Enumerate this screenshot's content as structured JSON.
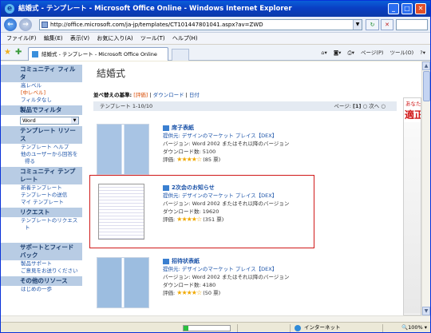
{
  "window": {
    "title": "結婚式 - テンプレート - Microsoft Office Online - Windows Internet Explorer",
    "minimize": "_",
    "maximize": "□",
    "close": "✕"
  },
  "address": {
    "url": "http://office.microsoft.com/ja-jp/templates/CT101447801041.aspx?av=ZWD",
    "refresh": "↻",
    "stop": "✕"
  },
  "menu": {
    "items": [
      "ファイル(F)",
      "編集(E)",
      "表示(V)",
      "お気に入り(A)",
      "ツール(T)",
      "ヘルプ(H)"
    ]
  },
  "tab": {
    "label": "結婚式 - テンプレート - Microsoft Office Online"
  },
  "commands": {
    "page": "ページ(P)",
    "tools": "ツール(O)"
  },
  "sidebar": {
    "community_filter": "コミュニティ フィルタ",
    "community_items": [
      "高レベル",
      "[中レベル]",
      "フィルタなし"
    ],
    "product_filter": "製品でフィルタ",
    "product_select": "Word",
    "template_resources": "テンプレート リソース",
    "resource_items": [
      "テンプレート ヘルプ",
      "他のユーザーから回答を得る"
    ],
    "community_templates": "コミュニティ テンプレート",
    "community_template_items": [
      "新着テンプレート",
      "テンプレートの送信",
      "マイ テンプレート"
    ],
    "request": "リクエスト",
    "request_items": [
      "テンプレートのリクエスト"
    ],
    "support": "サポートとフィードバック",
    "support_items": [
      "製品サポート",
      "ご意見をお送りください"
    ],
    "other": "その他のリソース",
    "other_items": [
      "はじめの一歩"
    ]
  },
  "main": {
    "title": "結婚式",
    "sort_label": "並べ替えの基準:",
    "sort_active": "[評価]",
    "sort_downloads": "ダウンロード",
    "sort_date": "日付",
    "count": "テンプレート 1-10/10",
    "page_label": "ページ:",
    "page_current": "[1]",
    "next": "次へ"
  },
  "templates": [
    {
      "name": "席子表紙",
      "provider": "提供元: デザインのマーケット プレイス【DEX】",
      "version": "バージョン: Word 2002 またはそれ以降のバージョン",
      "downloads": "ダウンロード数: 5100",
      "rating_label": "評価:",
      "rating": 4,
      "votes": "(85 票)"
    },
    {
      "name": "2次会のお知らせ",
      "provider": "提供元: デザインのマーケット プレイス【DEX】",
      "version": "バージョン: Word 2002 またはそれ以降のバージョン",
      "downloads": "ダウンロード数: 19620",
      "rating_label": "評価:",
      "rating": 4,
      "votes": "(351 票)"
    },
    {
      "name": "招待状表紙",
      "provider": "提供元: デザインのマーケット プレイス【DEX】",
      "version": "バージョン: Word 2002 またはそれ以降のバージョン",
      "downloads": "ダウンロード数: 4180",
      "rating_label": "評価:",
      "rating": 4,
      "votes": "(50 票)"
    }
  ],
  "ad": {
    "line1": "あなた",
    "line2": "適正"
  },
  "status": {
    "zone": "インターネット",
    "zoom": "100%"
  },
  "colors": {
    "titlebar": "#0a3fc4",
    "link": "#1a52a8",
    "highlight": "#d01818"
  }
}
